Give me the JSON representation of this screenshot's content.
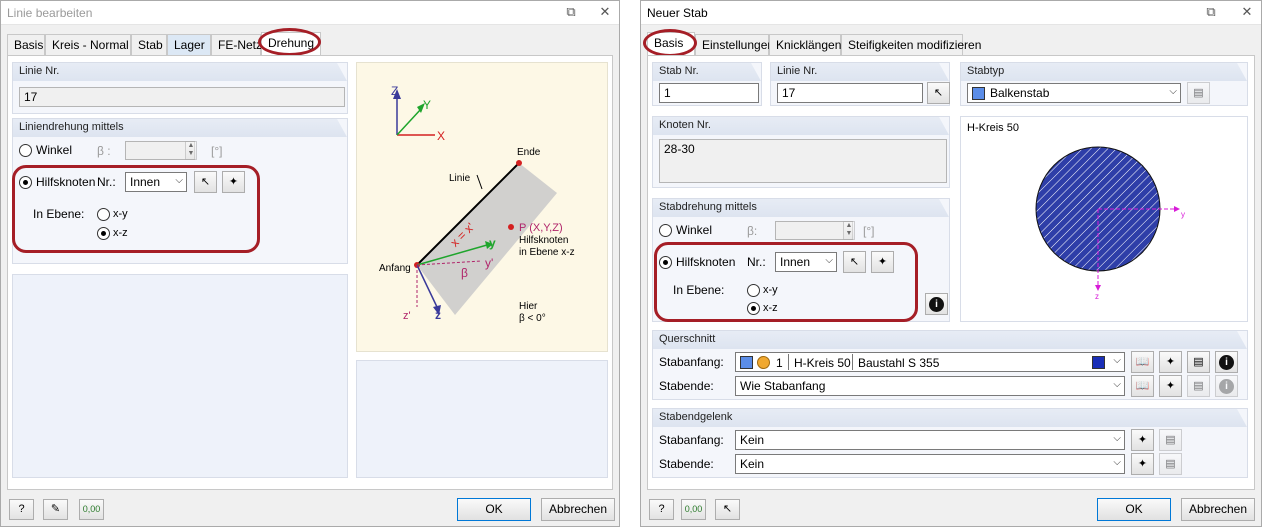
{
  "left_dialog": {
    "title": "Linie bearbeiten",
    "tabs": [
      "Basis",
      "Kreis - Normal",
      "Stab",
      "Lager",
      "FE-Netz",
      "Drehung"
    ],
    "linie_nr_label": "Linie Nr.",
    "linie_nr_value": "17",
    "drehung_group": "Liniendrehung mittels",
    "winkel_label": "Winkel",
    "beta_label": "β :",
    "angle_unit": "[°]",
    "hilfsknoten_label": "Hilfsknoten",
    "nr_label": "Nr.:",
    "nr_value": "Innen",
    "ebene_label": "In Ebene:",
    "xy_label": "x-y",
    "xz_label": "x-z",
    "diagram": {
      "axis_z": "Z",
      "axis_y": "Y",
      "axis_x": "X",
      "ende": "Ende",
      "linie": "Linie",
      "anfang": "Anfang",
      "p_label": "P (X,Y,Z)",
      "hilf1": "Hilfsknoten",
      "hilf2": "in Ebene x-z",
      "hier1": "Hier",
      "hier2": "β < 0°",
      "x_local": "x = x'",
      "y_local": "y",
      "y_prime": "y'",
      "beta": "β",
      "z_prime": "z'",
      "z_local": "z"
    },
    "ok": "OK",
    "cancel": "Abbrechen"
  },
  "right_dialog": {
    "title": "Neuer Stab",
    "tabs": [
      "Basis",
      "Einstellungen",
      "Knicklängen",
      "Steifigkeiten modifizieren"
    ],
    "stab_nr_label": "Stab Nr.",
    "stab_nr_value": "1",
    "linie_nr_label": "Linie Nr.",
    "linie_nr_value": "17",
    "stabtyp_label": "Stabtyp",
    "stabtyp_value": "Balkenstab",
    "knoten_label": "Knoten Nr.",
    "knoten_value": "28-30",
    "preview_title": "H-Kreis 50",
    "preview_y": "y",
    "preview_z": "z",
    "drehung_group": "Stabdrehung mittels",
    "winkel_label": "Winkel",
    "beta_label": "β:",
    "angle_unit": "[°]",
    "hilfsknoten_label": "Hilfsknoten",
    "nr_label": "Nr.:",
    "nr_value": "Innen",
    "ebene_label": "In Ebene:",
    "xy_label": "x-y",
    "xz_label": "x-z",
    "querschnitt_group": "Querschnitt",
    "stabanfang_label": "Stabanfang:",
    "stabende_label": "Stabende:",
    "qs_number": "1",
    "qs_name": "H-Kreis 50",
    "qs_material": "Baustahl S 355",
    "qs_ende_value": "Wie Stabanfang",
    "gelenk_group": "Stabendgelenk",
    "gelenk_anfang_label": "Stabanfang:",
    "gelenk_ende_label": "Stabende:",
    "gelenk_anfang_value": "Kein",
    "gelenk_ende_value": "Kein",
    "ok": "OK",
    "cancel": "Abbrechen"
  },
  "colors": {
    "highlight": "#a51e26",
    "section_fill": "#2e3ea8",
    "axis_magenta": "#d81bd8"
  }
}
